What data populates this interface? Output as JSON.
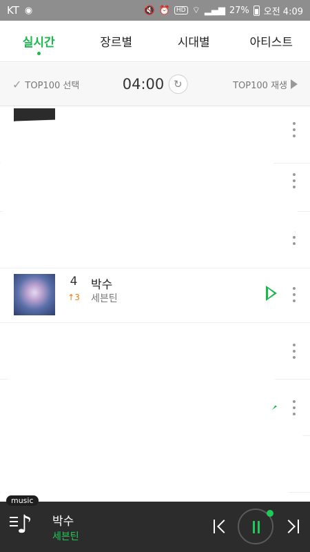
{
  "status_bar": {
    "carrier": "KT",
    "battery_text": "27%",
    "time": "오전 4:09",
    "hd_label": "HD"
  },
  "tabs": [
    {
      "label": "실시간",
      "active": true
    },
    {
      "label": "장르별",
      "active": false
    },
    {
      "label": "시대별",
      "active": false
    },
    {
      "label": "아티스트",
      "active": false
    }
  ],
  "toolbar": {
    "select_label": "TOP100 선택",
    "time": "04:00",
    "play_label": "TOP100 재생"
  },
  "chart_rows": [
    {
      "rank": "4",
      "change": "↑3",
      "title": "박수",
      "artist": "세븐틴"
    }
  ],
  "player": {
    "tag": "music",
    "title": "박수",
    "artist": "세븐틴"
  },
  "colors": {
    "accent": "#19b84b",
    "rank_change_up": "#f07b00",
    "player_bg": "#2c2c2c"
  }
}
